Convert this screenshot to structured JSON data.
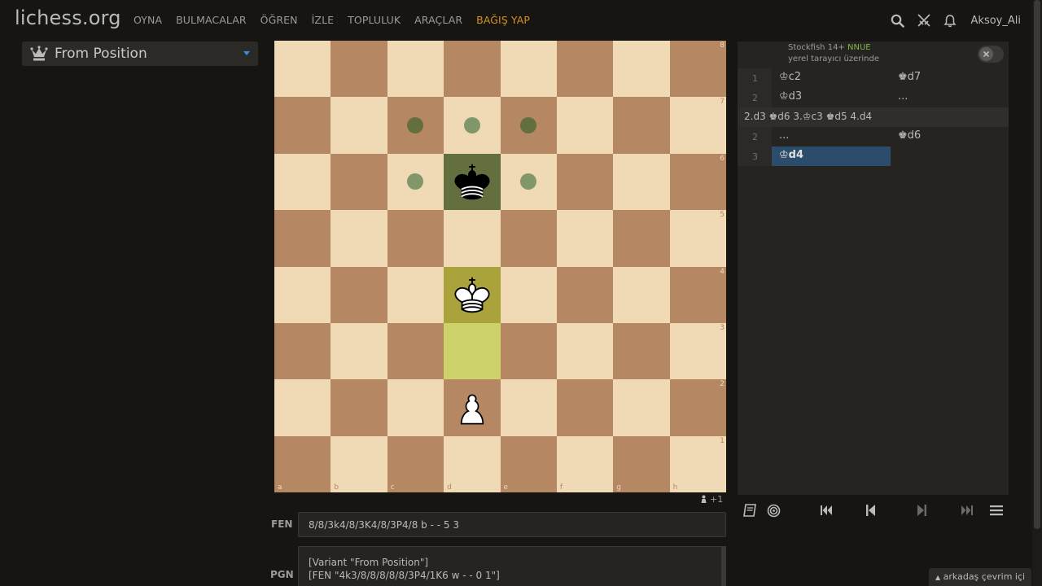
{
  "header": {
    "logo": "lichess.org",
    "nav": [
      "OYNA",
      "BULMACALAR",
      "ÖĞREN",
      "İZLE",
      "TOPLULUK",
      "ARAÇLAR"
    ],
    "donate": "BAĞIŞ YAP",
    "username": "Aksoy_Ali",
    "icons": [
      "search-icon",
      "swords-icon",
      "bell-icon"
    ]
  },
  "variant": {
    "name": "From Position",
    "icon": "queen-crown-icon"
  },
  "board": {
    "ranks": [
      "8",
      "7",
      "6",
      "5",
      "4",
      "3",
      "2",
      "1"
    ],
    "files": [
      "a",
      "b",
      "c",
      "d",
      "e",
      "f",
      "g",
      "h"
    ],
    "colors": {
      "light": "#f0d9b5",
      "dark": "#b58863",
      "last_move": "#cdd26a",
      "selected": "#646f40"
    },
    "pieces": [
      {
        "piece": "black-king",
        "square": "d6",
        "glyph": "♚"
      },
      {
        "piece": "white-king",
        "square": "d4",
        "glyph": "♔"
      },
      {
        "piece": "white-pawn",
        "square": "d2",
        "glyph": "♙"
      }
    ],
    "move_dots": [
      "c7",
      "d7",
      "e7",
      "c6",
      "e6"
    ],
    "highlights": {
      "selected": "d6",
      "last_move_from": "d3",
      "last_move_to": "d4"
    },
    "material": "+1"
  },
  "fen": {
    "label": "FEN",
    "value": "8/8/3k4/8/3K4/8/3P4/8 b - - 5 3"
  },
  "pgn": {
    "label": "PGN",
    "line1": "[Variant \"From Position\"]",
    "line2": "[FEN \"4k3/8/8/8/8/8/3P4/1K6 w - - 0 1\"]"
  },
  "ceval": {
    "engine": "Stockfish 14+",
    "nnue": "NNUE",
    "sub": "yerel tarayıcı üzerinde"
  },
  "moves": {
    "rows": [
      {
        "num": "1",
        "white": "♔c2",
        "black": "♚d7"
      },
      {
        "num": "2",
        "white": "♔d3",
        "black": "..."
      }
    ],
    "variation": "2.d3 ♚d6 3.♔c3 ♚d5 4.d4",
    "rows2": [
      {
        "num": "2",
        "white": "...",
        "black": "♚d6"
      },
      {
        "num": "3",
        "white": "♔d4",
        "black": ""
      }
    ]
  },
  "friends": "arkadaş çevrim içi"
}
